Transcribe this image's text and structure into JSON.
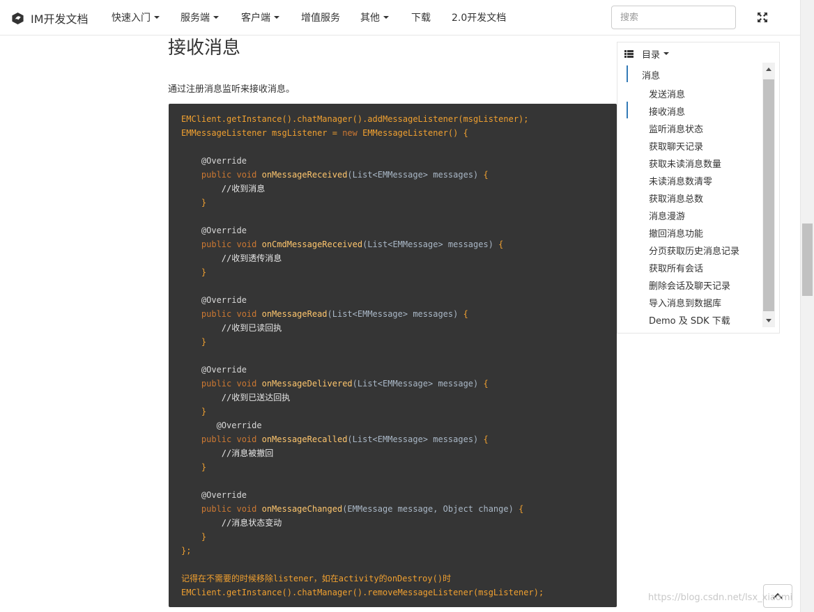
{
  "navbar": {
    "brand": "IM开发文档",
    "items": [
      {
        "label": "快速入门",
        "dropdown": true
      },
      {
        "label": "服务端",
        "dropdown": true
      },
      {
        "label": "客户端",
        "dropdown": true
      },
      {
        "label": "增值服务",
        "dropdown": false
      },
      {
        "label": "其他",
        "dropdown": true
      },
      {
        "label": "下载",
        "dropdown": false
      },
      {
        "label": "2.0开发文档",
        "dropdown": false
      }
    ],
    "search_placeholder": "搜索"
  },
  "main": {
    "heading": "接收消息",
    "intro": "通过注册消息监听来接收消息。"
  },
  "code_lines": [
    [
      [
        "n",
        "EMClient.getInstance().chatManager().addMessageListener(msgListener);"
      ]
    ],
    [
      [
        "n",
        "EMMessageListener msgListener = "
      ],
      [
        "k",
        "new"
      ],
      [
        "n",
        " EMMessageListener() {"
      ]
    ],
    [
      [
        "n",
        ""
      ]
    ],
    [
      [
        "a",
        "    @Override"
      ]
    ],
    [
      [
        "k",
        "    public void "
      ],
      [
        "f",
        "onMessageReceived"
      ],
      [
        "p",
        "(List<EMMessage> messages) "
      ],
      [
        "n",
        "{"
      ]
    ],
    [
      [
        "c",
        "        //收到消息"
      ]
    ],
    [
      [
        "n",
        "    }"
      ]
    ],
    [
      [
        "n",
        ""
      ]
    ],
    [
      [
        "a",
        "    @Override"
      ]
    ],
    [
      [
        "k",
        "    public void "
      ],
      [
        "f",
        "onCmdMessageReceived"
      ],
      [
        "p",
        "(List<EMMessage> messages) "
      ],
      [
        "n",
        "{"
      ]
    ],
    [
      [
        "c",
        "        //收到透传消息"
      ]
    ],
    [
      [
        "n",
        "    }"
      ]
    ],
    [
      [
        "n",
        ""
      ]
    ],
    [
      [
        "a",
        "    @Override"
      ]
    ],
    [
      [
        "k",
        "    public void "
      ],
      [
        "f",
        "onMessageRead"
      ],
      [
        "p",
        "(List<EMMessage> messages) "
      ],
      [
        "n",
        "{"
      ]
    ],
    [
      [
        "c",
        "        //收到已读回执"
      ]
    ],
    [
      [
        "n",
        "    }"
      ]
    ],
    [
      [
        "n",
        ""
      ]
    ],
    [
      [
        "a",
        "    @Override"
      ]
    ],
    [
      [
        "k",
        "    public void "
      ],
      [
        "f",
        "onMessageDelivered"
      ],
      [
        "p",
        "(List<EMMessage> message) "
      ],
      [
        "n",
        "{"
      ]
    ],
    [
      [
        "c",
        "        //收到已送达回执"
      ]
    ],
    [
      [
        "n",
        "    }"
      ]
    ],
    [
      [
        "a",
        "       @Override"
      ]
    ],
    [
      [
        "k",
        "    public void "
      ],
      [
        "f",
        "onMessageRecalled"
      ],
      [
        "p",
        "(List<EMMessage> messages) "
      ],
      [
        "n",
        "{"
      ]
    ],
    [
      [
        "c",
        "        //消息被撤回"
      ]
    ],
    [
      [
        "n",
        "    }"
      ]
    ],
    [
      [
        "n",
        ""
      ]
    ],
    [
      [
        "a",
        "    @Override"
      ]
    ],
    [
      [
        "k",
        "    public void "
      ],
      [
        "f",
        "onMessageChanged"
      ],
      [
        "p",
        "(EMMessage message, Object change) "
      ],
      [
        "n",
        "{"
      ]
    ],
    [
      [
        "c",
        "        //消息状态变动"
      ]
    ],
    [
      [
        "n",
        "    }"
      ]
    ],
    [
      [
        "n",
        "};"
      ]
    ],
    [
      [
        "n",
        ""
      ]
    ],
    [
      [
        "n",
        "记得在不需要的时候移除listener，如在activity的onDestroy()时"
      ]
    ],
    [
      [
        "n",
        "EMClient.getInstance().chatManager().removeMessageListener(msgListener);"
      ]
    ]
  ],
  "toc": {
    "header": "目录",
    "items": [
      {
        "label": "消息",
        "level": 0,
        "active": true
      },
      {
        "label": "发送消息",
        "level": 1,
        "active": false
      },
      {
        "label": "接收消息",
        "level": 1,
        "active": true
      },
      {
        "label": "监听消息状态",
        "level": 1,
        "active": false
      },
      {
        "label": "获取聊天记录",
        "level": 1,
        "active": false
      },
      {
        "label": "获取未读消息数量",
        "level": 1,
        "active": false
      },
      {
        "label": "未读消息数清零",
        "level": 1,
        "active": false
      },
      {
        "label": "获取消息总数",
        "level": 1,
        "active": false
      },
      {
        "label": "消息漫游",
        "level": 1,
        "active": false
      },
      {
        "label": "撤回消息功能",
        "level": 1,
        "active": false
      },
      {
        "label": "分页获取历史消息记录",
        "level": 1,
        "active": false
      },
      {
        "label": "获取所有会话",
        "level": 1,
        "active": false
      },
      {
        "label": "删除会话及聊天记录",
        "level": 1,
        "active": false
      },
      {
        "label": "导入消息到数据库",
        "level": 1,
        "active": false
      },
      {
        "label": "Demo 及 SDK 下载",
        "level": 1,
        "active": false
      }
    ]
  },
  "watermark": "https://blog.csdn.net/lsx_xiaomi",
  "colors": {
    "code_bg": "#353535",
    "code_text": "#f0a030",
    "toc_active": "#337ab7"
  },
  "icons": {
    "brand": "brand-logo-icon",
    "expand": "fullscreen-icon",
    "toc": "list-icon",
    "back_to_top": "chevron-up-icon"
  }
}
